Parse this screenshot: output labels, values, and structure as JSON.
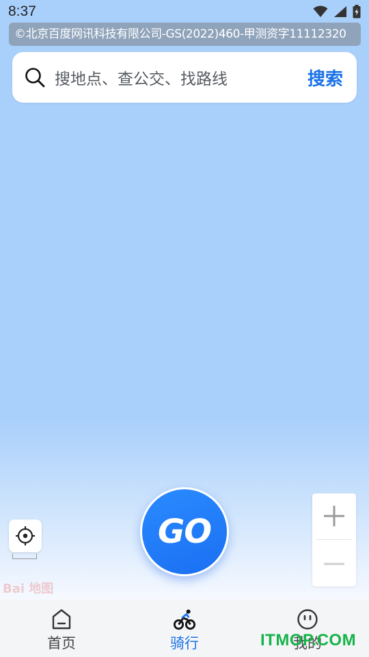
{
  "status_bar": {
    "time": "8:37",
    "icons": [
      "wifi-icon",
      "cell-signal-icon",
      "battery-charging-icon"
    ]
  },
  "map": {
    "copyright": "©北京百度网讯科技有限公司-GS(2022)460-甲测资字11112320",
    "logo_text": "Bai 地图",
    "background_color": "#a9cffb"
  },
  "search": {
    "placeholder": "搜地点、查公交、找路线",
    "button_label": "搜索",
    "accent_color": "#1a73e8"
  },
  "go_button": {
    "label": "GO"
  },
  "zoom": {
    "in_icon": "plus-icon",
    "out_icon": "minus-icon"
  },
  "tabs": [
    {
      "label": "首页",
      "icon": "home-icon",
      "active": false
    },
    {
      "label": "骑行",
      "icon": "cycling-icon",
      "active": true
    },
    {
      "label": "我的",
      "icon": "profile-face-icon",
      "active": false
    }
  ],
  "watermark": "ITMOP.COM"
}
